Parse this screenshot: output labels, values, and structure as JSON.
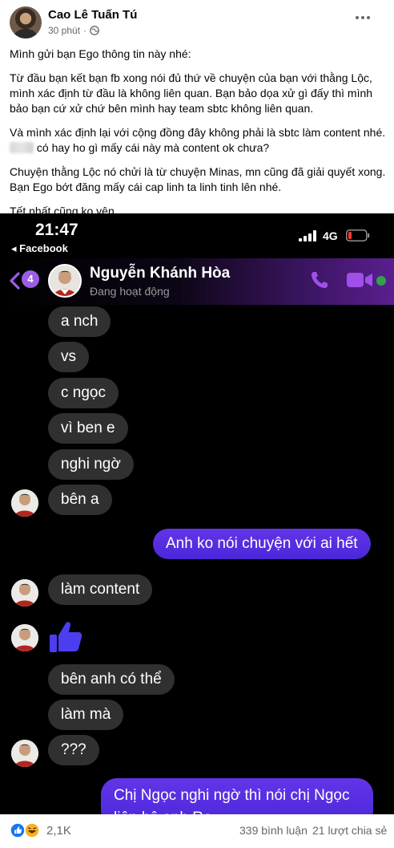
{
  "post": {
    "author": "Cao Lê Tuấn Tú",
    "time": "30 phút",
    "dot": "·",
    "paragraphs": {
      "p1": "Mình gửi bạn Ego thông tin này nhé:",
      "p2": "Từ đầu bạn kết bạn fb xong nói đủ thứ về chuyện của bạn với thằng Lộc, mình xác định từ đầu là không liên quan. Bạn bảo dọa xử gì đấy thì mình bảo bạn cứ xử chứ bên mình hay team sbtc không liên quan.",
      "p3_line1": "Và mình xác định lại với cộng đồng đây không phải là sbtc làm content nhé.",
      "p3_line2": "có hay ho gì mấy cái này mà content ok chưa?",
      "p4": "Chuyện thằng Lộc nó chửi là từ chuyện Minas, mn cũng đã giải quyết xong. Bạn Ego bớt đăng mấy cái cap linh ta linh tinh lên nhé.",
      "p5": "Tết nhất cũng ko yên."
    }
  },
  "screenshot": {
    "status": {
      "time": "21:47",
      "back_app": "◂ Facebook",
      "network": "4G"
    },
    "chat": {
      "badge": "4",
      "name": "Nguyễn Khánh Hòa",
      "status": "Đang hoạt động",
      "messages": [
        {
          "dir": "in",
          "text": "a nch"
        },
        {
          "dir": "in",
          "text": "vs"
        },
        {
          "dir": "in",
          "text": "c ngọc"
        },
        {
          "dir": "in",
          "text": "vì ben e"
        },
        {
          "dir": "in",
          "text": "nghi ngờ"
        },
        {
          "dir": "in",
          "text": "bên a"
        },
        {
          "dir": "out",
          "text": "Anh ko nói chuyện với ai hết"
        },
        {
          "dir": "in",
          "text": "làm content"
        },
        {
          "dir": "in",
          "text": "bên anh có thể"
        },
        {
          "dir": "in",
          "text": "làm mà"
        },
        {
          "dir": "in",
          "text": "???"
        },
        {
          "dir": "out",
          "text": "Chị Ngọc nghi ngờ thì nói chị Ngọc",
          "text2": "liên hệ anh Ro"
        }
      ]
    },
    "colors": {
      "outgoing": "#5a2ee6",
      "incoming": "#303030",
      "header_purple": "#5a1f8f"
    }
  },
  "footer": {
    "reactions": "2,1K",
    "comments": "339 bình luận",
    "shares": "21 lượt chia sẻ"
  }
}
